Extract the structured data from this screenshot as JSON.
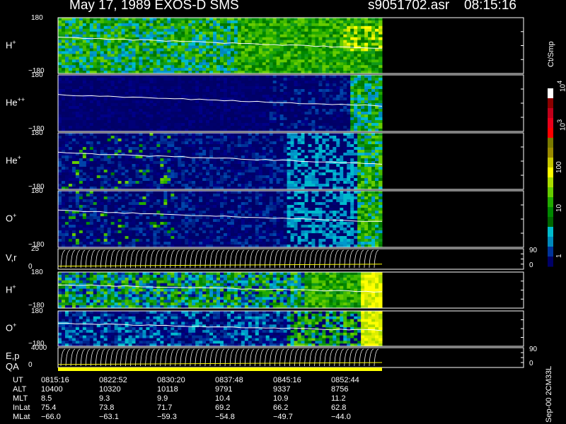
{
  "header": {
    "title": "May 17, 1989    EXOS-D SMS",
    "file": "s9051702.asr",
    "time": "08:15:16"
  },
  "side": {
    "units": "Ct/Smp",
    "footer": "Sep-00  2CM33L"
  },
  "colorbar": {
    "ticks": [
      "10",
      "10",
      "100",
      "10",
      "10",
      "1"
    ],
    "exponents": [
      "4",
      "3"
    ],
    "colors": [
      "#ffffff",
      "#8b0000",
      "#c0001a",
      "#e8001a",
      "#ff0000",
      "#7a7a00",
      "#9a8a00",
      "#c8c800",
      "#ffff00",
      "#aadd00",
      "#66cc00",
      "#22aa00",
      "#008800",
      "#006600",
      "#00bbcc",
      "#0088bb",
      "#003399",
      "#000066"
    ]
  },
  "chart_data": {
    "type": "heatmap",
    "panels": [
      {
        "id": "h-plus",
        "label": "H",
        "sup": "+",
        "ylim": [
          -180,
          180
        ],
        "ticks": [
          "180",
          "−180"
        ]
      },
      {
        "id": "he-pp",
        "label": "He",
        "sup": "++",
        "ylim": [
          -180,
          180
        ],
        "ticks": [
          "180",
          "−180"
        ]
      },
      {
        "id": "he-plus",
        "label": "He",
        "sup": "+",
        "ylim": [
          -180,
          180
        ],
        "ticks": [
          "180",
          "−180"
        ]
      },
      {
        "id": "o-plus",
        "label": "O",
        "sup": "+",
        "ylim": [
          -180,
          180
        ],
        "ticks": [
          "180",
          "−180"
        ]
      },
      {
        "id": "vr",
        "label": "V,r",
        "sup": "",
        "ylim": [
          0,
          25
        ],
        "ticks": [
          "25",
          "0"
        ],
        "right_ticks": [
          "90",
          "0"
        ]
      },
      {
        "id": "h-plus-2",
        "label": "H",
        "sup": "+",
        "ylim": [
          -180,
          180
        ],
        "ticks": [
          "180",
          "−180"
        ]
      },
      {
        "id": "o-plus-2",
        "label": "O",
        "sup": "+",
        "ylim": [
          -180,
          180
        ],
        "ticks": [
          "180",
          "−180"
        ]
      },
      {
        "id": "ep",
        "label": "E,p",
        "sup": "",
        "ylim": [
          0,
          4000
        ],
        "ticks": [
          "4000",
          "0"
        ],
        "right_ticks": [
          "90",
          "0"
        ]
      }
    ],
    "qa_label": "QA",
    "ut_table": {
      "rows": [
        {
          "name": "UT",
          "values": [
            "0815:16",
            "0822:52",
            "0830:20",
            "0837:48",
            "0845:16",
            "0852:44"
          ]
        },
        {
          "name": "ALT",
          "values": [
            "10400",
            "10320",
            "10118",
            "9791",
            "9337",
            "8756"
          ]
        },
        {
          "name": "MLT",
          "values": [
            "8.5",
            "9.3",
            "9.9",
            "10.4",
            "10.9",
            "11.2"
          ]
        },
        {
          "name": "InLat",
          "values": [
            "75.4",
            "73.8",
            "71.7",
            "69.2",
            "66.2",
            "62.8"
          ]
        },
        {
          "name": "MLat",
          "values": [
            "−66.0",
            "−63.1",
            "−59.3",
            "−54.8",
            "−49.7",
            "−44.0"
          ]
        }
      ]
    }
  }
}
